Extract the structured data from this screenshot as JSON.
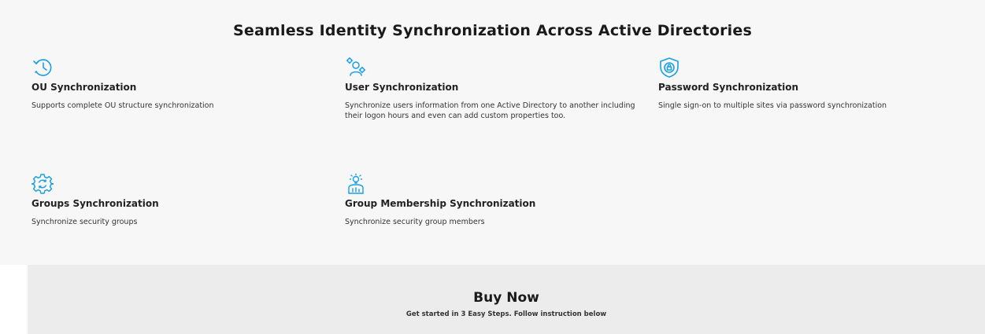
{
  "accent_color": "#1ba0e2",
  "features_section": {
    "title": "Seamless Identity Synchronization Across Active Directories",
    "features": [
      {
        "icon": "clock-sync-icon",
        "title": "OU Synchronization",
        "description": "Supports complete OU structure synchronization"
      },
      {
        "icon": "users-gear-icon",
        "title": "User Synchronization",
        "description": "Synchronize users information from one Active Directory to another including their logon hours and even can add custom properties too."
      },
      {
        "icon": "shield-lock-icon",
        "title": "Password Synchronization",
        "description": "Single sign-on to multiple sites via password synchronization"
      },
      {
        "icon": "gear-sync-icon",
        "title": "Groups Synchronization",
        "description": "Synchronize security groups"
      },
      {
        "icon": "idea-person-icon",
        "title": "Group Membership Synchronization",
        "description": "Synchronize security group members"
      }
    ]
  },
  "buy_section": {
    "title": "Buy Now",
    "subtitle": "Get started in 3 Easy Steps. Follow instruction below"
  }
}
